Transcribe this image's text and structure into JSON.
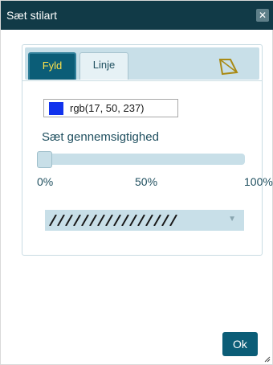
{
  "dialog": {
    "title": "Sæt stilart",
    "close_icon": "close-icon"
  },
  "tabs": [
    {
      "label": "Fyld",
      "active": true
    },
    {
      "label": "Linje",
      "active": false
    }
  ],
  "shape_tab_icon": "polygon-shape-icon",
  "fill": {
    "color_value": "rgb(17, 50, 237)",
    "swatch_color": "#1132ed",
    "opacity_label": "Sæt gennemsigtighed",
    "opacity_value": 0,
    "ticks": [
      "0%",
      "50%",
      "100%"
    ],
    "pattern": "diagonal-hatch"
  },
  "ok_label": "Ok",
  "colors": {
    "titlebar": "#113a47",
    "accent": "#0b5d77",
    "tab_active_text": "#ffe24a",
    "panel_bg": "#c8dfe8"
  }
}
